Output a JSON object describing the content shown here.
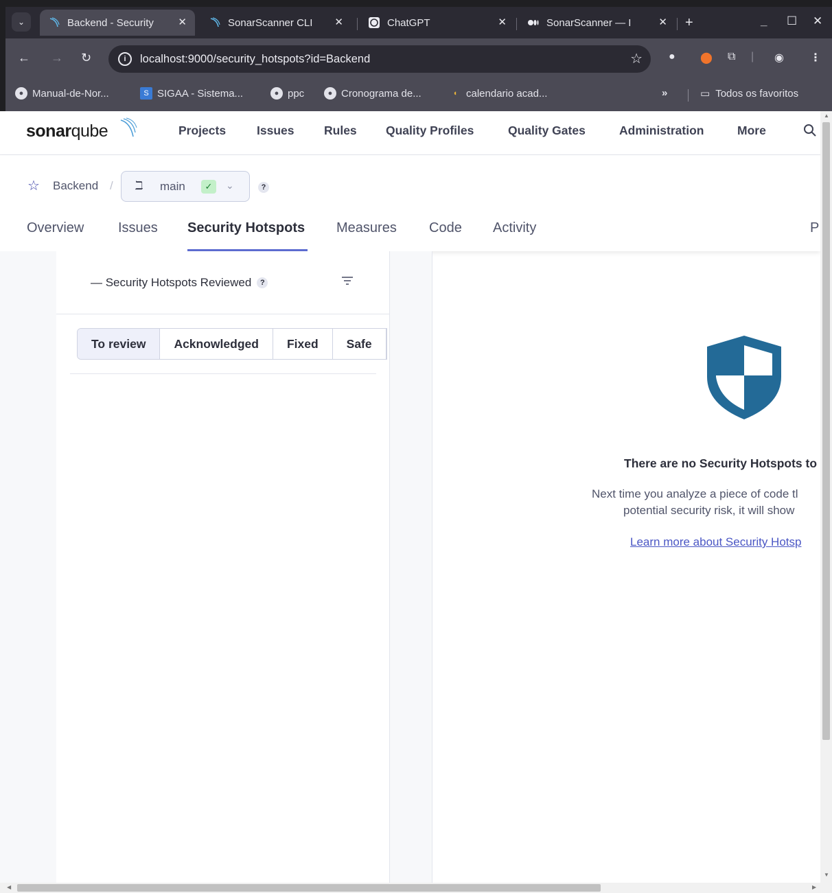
{
  "browser": {
    "tabs": [
      {
        "title": "Backend - Security",
        "active": true
      },
      {
        "title": "SonarScanner CLI",
        "active": false
      },
      {
        "title": "ChatGPT",
        "active": false
      },
      {
        "title": "SonarScanner — I",
        "active": false
      }
    ],
    "url": "localhost:9000/security_hotspots?id=Backend",
    "bookmarks": [
      {
        "label": "Manual-de-Nor...",
        "icon": "globe-icon"
      },
      {
        "label": "SIGAA - Sistema...",
        "icon": "sigaa-icon"
      },
      {
        "label": "ppc",
        "icon": "globe-icon"
      },
      {
        "label": "Cronograma de...",
        "icon": "globe-icon"
      },
      {
        "label": "calendario acad...",
        "icon": "rainbow-icon"
      }
    ],
    "bookmarks_more": "»",
    "all_bookmarks": "Todos os favoritos"
  },
  "app": {
    "logo": {
      "bold": "sonar",
      "light": "qube"
    },
    "topnav": [
      "Projects",
      "Issues",
      "Rules",
      "Quality Profiles",
      "Quality Gates",
      "Administration",
      "More"
    ],
    "project": "Backend",
    "branch": "main",
    "help": "?",
    "project_tabs": [
      "Overview",
      "Issues",
      "Security Hotspots",
      "Measures",
      "Code",
      "Activity"
    ],
    "project_tab_clipped": "P",
    "reviewed_label": "— Security Hotspots Reviewed",
    "status_filters": [
      "To review",
      "Acknowledged",
      "Fixed",
      "Safe"
    ],
    "empty_state": {
      "title": "There are no Security Hotspots to",
      "desc_line1": "Next time you analyze a piece of code tl",
      "desc_line2": "potential security risk, it will show",
      "link": "Learn more about Security Hotsp"
    },
    "colors": {
      "accent": "#5d6cd0",
      "shield": "#236a97",
      "link": "#4a56c4"
    }
  }
}
